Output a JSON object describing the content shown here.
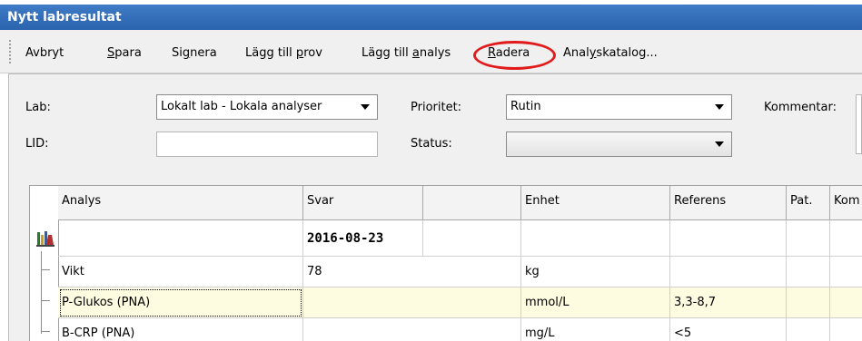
{
  "window": {
    "title": "Nytt labresultat"
  },
  "toolbar": {
    "items": [
      {
        "pre": "Avbryt",
        "u": "",
        "post": ""
      },
      {
        "pre": "",
        "u": "S",
        "post": "para"
      },
      {
        "pre": "Si",
        "u": "g",
        "post": "nera"
      },
      {
        "pre": "Lägg till ",
        "u": "p",
        "post": "rov"
      },
      {
        "pre": "Lägg till ",
        "u": "a",
        "post": "nalys"
      },
      {
        "pre": "",
        "u": "R",
        "post": "adera"
      },
      {
        "pre": "Anal",
        "u": "y",
        "post": "skatalog..."
      }
    ],
    "highlight_color": "#e11b1b"
  },
  "form": {
    "lab_label": "Lab:",
    "lab_value": "Lokalt lab - Lokala analyser",
    "lid_label": "LID:",
    "lid_value": "",
    "priority_label": "Prioritet:",
    "priority_value": "Rutin",
    "status_label": "Status:",
    "status_value": "",
    "comment_label": "Kommentar:"
  },
  "grid": {
    "headers": [
      "Analys",
      "Svar",
      "",
      "Enhet",
      "Referens",
      "Pat.",
      "Kom"
    ],
    "date_row": {
      "svar": "2016-08-23"
    },
    "rows": [
      {
        "analys": "Vikt",
        "svar": "78",
        "enhet": "kg",
        "referens": "",
        "pat": ""
      },
      {
        "analys": "P-Glukos (PNA)",
        "svar": "",
        "enhet": "mmol/L",
        "referens": "3,3-8,7",
        "pat": ""
      },
      {
        "analys": "B-CRP (PNA)",
        "svar": "",
        "enhet": "mg/L",
        "referens": "<5",
        "pat": ""
      }
    ],
    "highlight_row_color": "#fdfbe0"
  }
}
